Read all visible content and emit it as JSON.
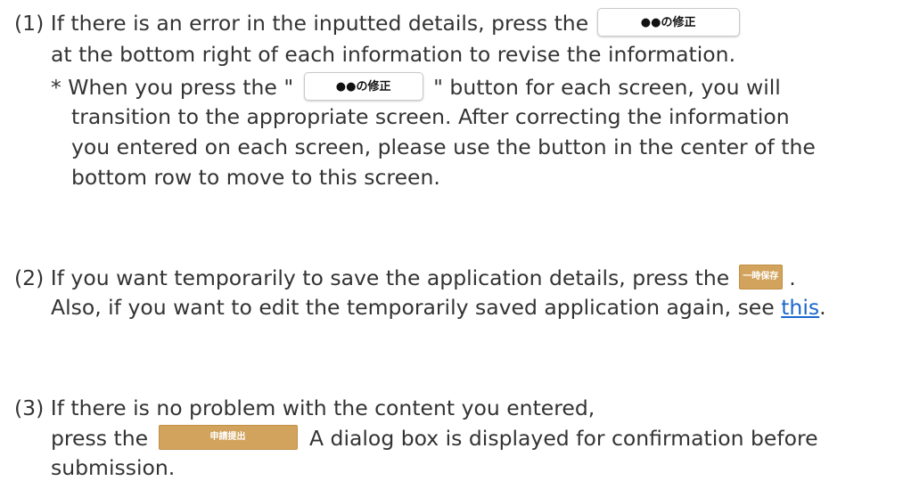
{
  "section1": {
    "line1_pre": "(1) If there is an error in the inputted details, press the",
    "button_revise": "●●の修正",
    "line2": "at the bottom right of each information to revise the information.",
    "line3_pre": "* When you press the \"",
    "line3_post": "\" button for each screen, you will",
    "line4": "transition to the appropriate screen. After correcting the information",
    "line5": "you entered on each screen, please use the button in the center of the",
    "line6": "bottom row to move to this screen."
  },
  "section2": {
    "line1_pre": "(2) If you want temporarily to save the application details, press the",
    "button_temp_save": "一時保存",
    "line1_post": ".",
    "line2_pre": "Also, if you want to edit the temporarily saved application again, see",
    "link_text": "this",
    "line2_post": "."
  },
  "section3": {
    "line1": "(3) If there is no problem with the content you entered,",
    "line2_pre": "press the",
    "button_submit": "申請提出",
    "line2_post": "A dialog box is displayed for confirmation before",
    "line3": "submission."
  },
  "colors": {
    "text": "#333333",
    "gold_button": "#d2a35c",
    "link": "#1a66cc"
  }
}
